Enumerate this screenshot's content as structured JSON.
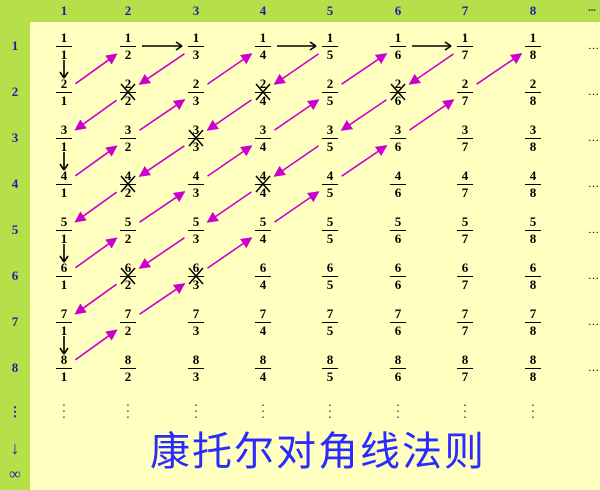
{
  "column_headers": [
    "1",
    "2",
    "3",
    "4",
    "5",
    "6",
    "7",
    "8",
    "..."
  ],
  "row_headers": [
    "1",
    "2",
    "3",
    "4",
    "5",
    "6",
    "7",
    "8",
    "⋮"
  ],
  "infinity_label": "∞",
  "title": "康托尔对角线法则",
  "grid": {
    "rows": 8,
    "cols": 8,
    "crossed": [
      [
        2,
        2
      ],
      [
        2,
        4
      ],
      [
        2,
        6
      ],
      [
        3,
        3
      ],
      [
        4,
        2
      ],
      [
        4,
        4
      ],
      [
        6,
        2
      ],
      [
        6,
        3
      ]
    ]
  },
  "colors": {
    "header_bg": "#b5e04a",
    "header_text": "#1f1fa3",
    "background": "#ffffc0",
    "path_arrow": "#cc00cc",
    "arrow_head": "#000000",
    "title": "#2b2bff"
  }
}
